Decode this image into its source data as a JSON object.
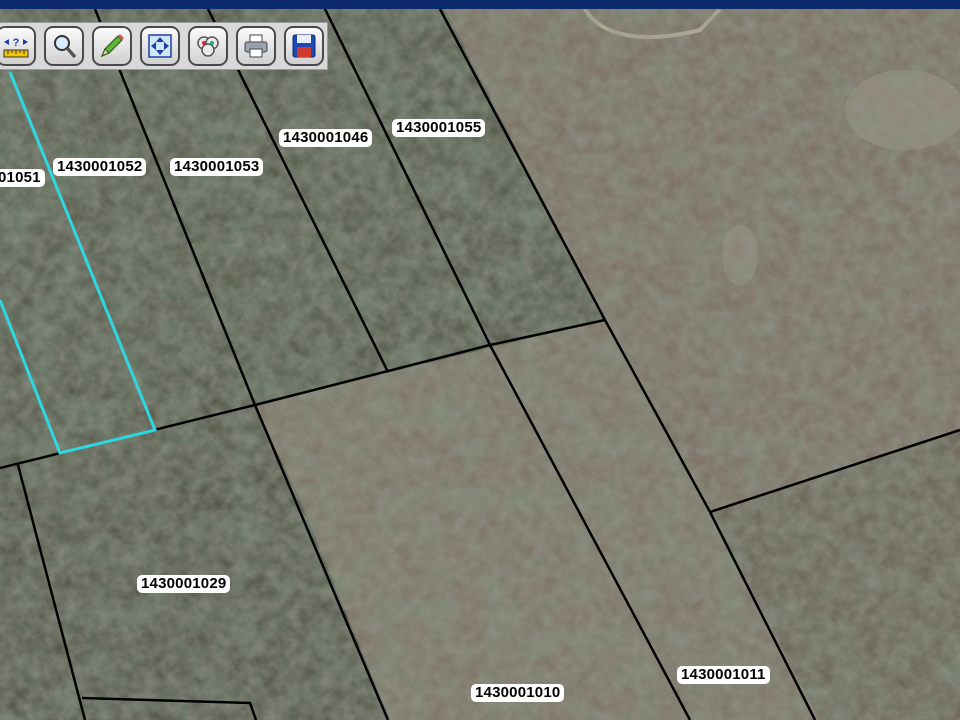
{
  "colors": {
    "header_bar": "#0c2a6c",
    "parcel_line": "#000000",
    "selected_parcel_line": "#2fd7e0",
    "label_background": "#ffffff"
  },
  "toolbar": {
    "tools": [
      {
        "icon": "measure-icon"
      },
      {
        "icon": "zoom-magnifier-icon"
      },
      {
        "icon": "draw-pencil-icon"
      },
      {
        "icon": "full-extent-icon"
      },
      {
        "icon": "layers-icon"
      },
      {
        "icon": "print-icon"
      },
      {
        "icon": "save-disk-icon"
      }
    ]
  },
  "map": {
    "type": "aerial parcel map",
    "parcel_labels": [
      "01051",
      "1430001052",
      "1430001053",
      "1430001046",
      "1430001055",
      "1430001029",
      "1430001010",
      "1430001011"
    ]
  }
}
